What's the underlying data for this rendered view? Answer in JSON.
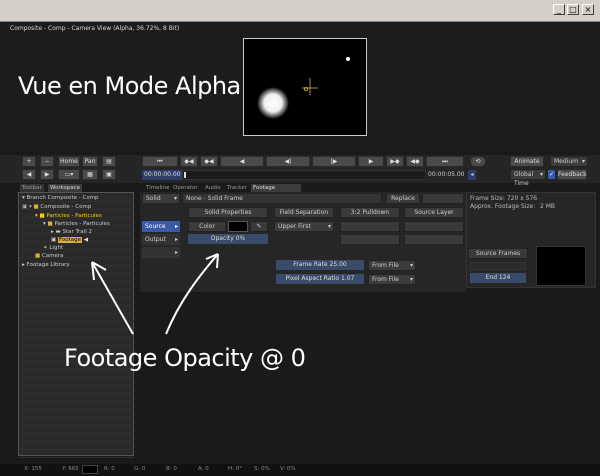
{
  "window": {
    "minimize": "_",
    "maximize": "□",
    "close": "×"
  },
  "viewer": {
    "title": "Composite - Comp - Camera View (Alpha, 36.72%, 8 Bit)"
  },
  "captions": {
    "alpha_mode": "Vue en Mode Alpha",
    "opacity": "Footage Opacity @ 0"
  },
  "left_toolbar": {
    "plus": "+",
    "minus": "−",
    "home": "Home",
    "pan": "Pan"
  },
  "transport": {
    "time_current": "00:00:00.00",
    "time_end": "00:00:05.00"
  },
  "right_toolbar": {
    "animate": "Animate",
    "quality": "Medium",
    "global_time": "Global Time",
    "feedback": "Feedback"
  },
  "tree_tabs": [
    "Toolbar",
    "Workspace"
  ],
  "tree_items": [
    {
      "label": "Branch Composite - Comp",
      "indent": 0
    },
    {
      "label": "Composite - Comp",
      "indent": 1
    },
    {
      "label": "Particles - Particules",
      "indent": 2
    },
    {
      "label": "Particles - Particules",
      "indent": 3
    },
    {
      "label": "Star Trail 2",
      "indent": 4
    },
    {
      "label": "Footage",
      "indent": 3
    },
    {
      "label": "Light",
      "indent": 2
    },
    {
      "label": "Camera",
      "indent": 1
    },
    {
      "label": "Footage Library",
      "indent": 0
    }
  ],
  "control_tabs": [
    "Timeline",
    "Operator",
    "Audio",
    "Tracker",
    "Footage Controls"
  ],
  "controls": {
    "solid_select": "Solid",
    "solid_name": "None - Solid Frame",
    "replace": "Replace",
    "side_tabs": [
      "Source",
      "Output",
      ""
    ],
    "solid_properties": "Solid Properties",
    "field_separation": "Field Separation",
    "pulldown": "3:2 Pulldown",
    "source_layer": "Source Layer",
    "color_label": "Color",
    "upper_first": "Upper First",
    "opacity": "Opacity 0%",
    "frame_rate": "Frame Rate 25.00",
    "frame_rate_select": "From File",
    "pixel_aspect": "Pixel Aspect Ratio 1.07",
    "pixel_aspect_select": "From File"
  },
  "info": {
    "frame_size": "Frame Size: 720 x 576",
    "approx_label": "Approx. Footage Size:",
    "approx_value": "2 MB",
    "source_frames": "Source Frames",
    "end": "End 124"
  },
  "status": {
    "x": "X: 155",
    "y": "Y: 665",
    "r": "R: 0",
    "g": "G: 0",
    "b": "B: 0",
    "a": "A: 0",
    "h": "H: 0°",
    "s": "S: 0%",
    "v": "V: 0%"
  },
  "colors": {
    "selection": "#ffcc00",
    "accent_blue": "#3a5aa8"
  }
}
